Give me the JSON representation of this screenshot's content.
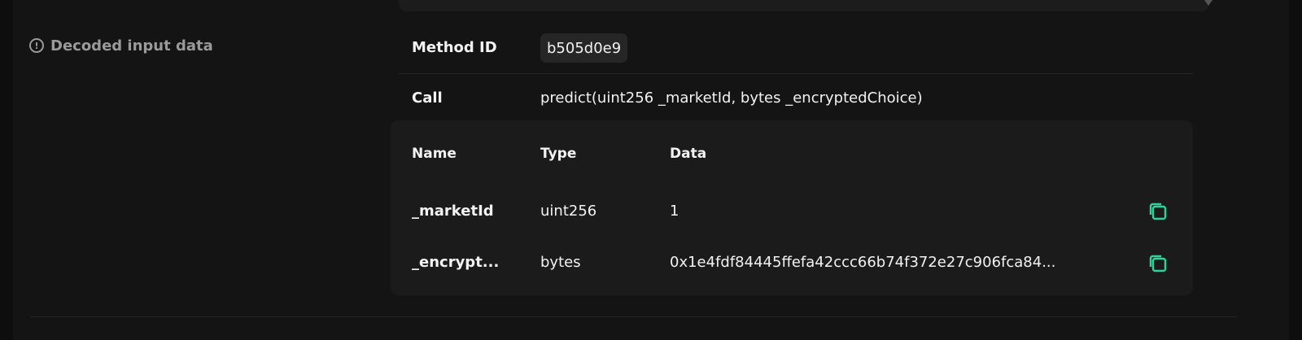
{
  "section": {
    "label": "Decoded input data",
    "icon": "info-icon"
  },
  "method": {
    "key": "Method ID",
    "value": "b505d0e9"
  },
  "call": {
    "key": "Call",
    "value": "predict(uint256 _marketId, bytes _encryptedChoice)"
  },
  "params": {
    "headers": {
      "name": "Name",
      "type": "Type",
      "data": "Data"
    },
    "rows": [
      {
        "name": "_marketId",
        "type": "uint256",
        "data": "1"
      },
      {
        "name": "_encrypt...",
        "type": "bytes",
        "data": "0x1e4fdf84445ffefa42ccc66b74f372e27c906fca84..."
      }
    ]
  },
  "colors": {
    "accent": "#2fd39a",
    "background": "#141414",
    "panel": "#1b1b1b"
  }
}
